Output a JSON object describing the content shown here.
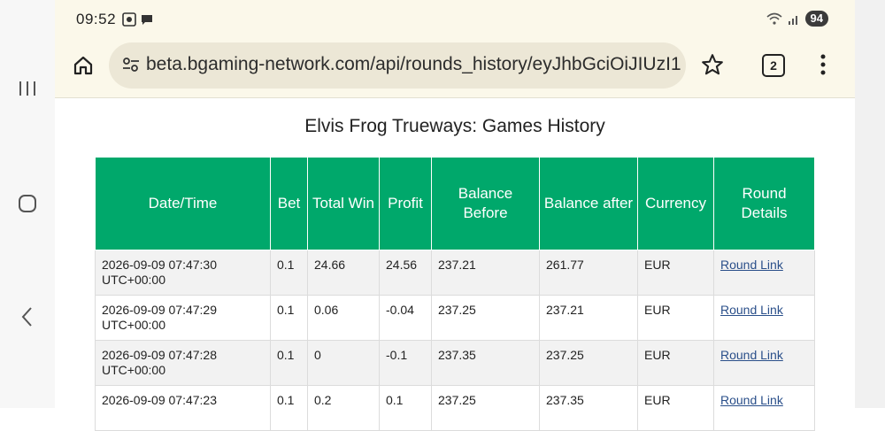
{
  "status_bar": {
    "time": "09:52",
    "battery": "94"
  },
  "browser": {
    "url": "beta.bgaming-network.com/api/rounds_history/eyJhbGciOiJIUzI1",
    "tab_count": "2"
  },
  "page": {
    "title": "Elvis Frog Trueways: Games History"
  },
  "table": {
    "headers": [
      "Date/Time",
      "Bet",
      "Total Win",
      "Profit",
      "Balance Before",
      "Balance after",
      "Currency",
      "Round Details"
    ],
    "rows": [
      {
        "datetime": "2026-09-09 07:47:30 UTC+00:00",
        "bet": "0.1",
        "total_win": "24.66",
        "profit": "24.56",
        "balance_before": "237.21",
        "balance_after": "261.77",
        "currency": "EUR",
        "link": "Round Link"
      },
      {
        "datetime": "2026-09-09 07:47:29 UTC+00:00",
        "bet": "0.1",
        "total_win": "0.06",
        "profit": "-0.04",
        "balance_before": "237.25",
        "balance_after": "237.21",
        "currency": "EUR",
        "link": "Round Link"
      },
      {
        "datetime": "2026-09-09 07:47:28 UTC+00:00",
        "bet": "0.1",
        "total_win": "0",
        "profit": "-0.1",
        "balance_before": "237.35",
        "balance_after": "237.25",
        "currency": "EUR",
        "link": "Round Link"
      },
      {
        "datetime": "2026-09-09 07:47:23",
        "bet": "0.1",
        "total_win": "0.2",
        "profit": "0.1",
        "balance_before": "237.25",
        "balance_after": "237.35",
        "currency": "EUR",
        "link": "Round Link"
      }
    ]
  },
  "colors": {
    "header_green": "#00a86b",
    "chrome_bg": "#fbf8ea",
    "url_bar_bg": "#ece7d6",
    "link": "#2a4f8a"
  },
  "icons": [
    "recents-icon",
    "home-nav-icon",
    "back-icon",
    "screenshot-icon",
    "chat-icon",
    "wifi-icon",
    "signal-icon",
    "home-icon",
    "tune-icon",
    "star-icon",
    "tabs-icon",
    "more-vert-icon"
  ]
}
